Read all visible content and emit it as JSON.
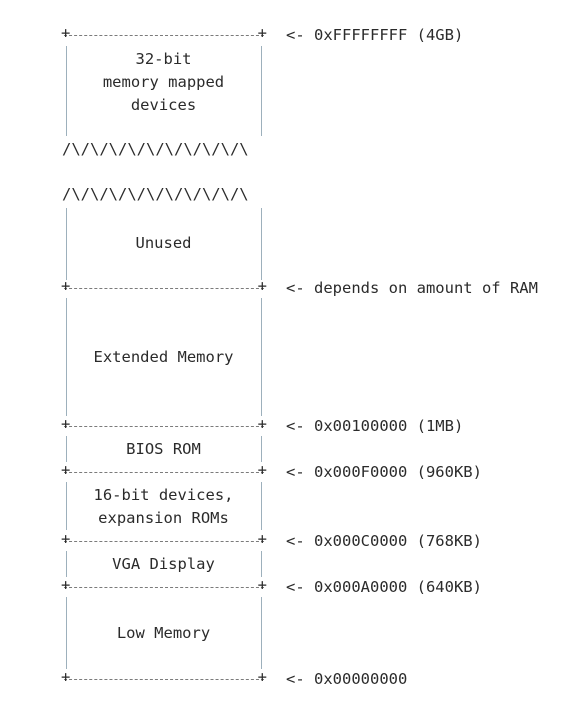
{
  "regions": [
    {
      "id": "32bit",
      "lines": [
        "32-bit",
        "memory mapped",
        "devices"
      ]
    },
    {
      "id": "unused",
      "lines": [
        "Unused"
      ]
    },
    {
      "id": "extended",
      "lines": [
        "Extended Memory"
      ]
    },
    {
      "id": "bios",
      "lines": [
        "BIOS ROM"
      ]
    },
    {
      "id": "16bit",
      "lines": [
        "16-bit devices,",
        "expansion ROMs"
      ]
    },
    {
      "id": "vga",
      "lines": [
        "VGA Display"
      ]
    },
    {
      "id": "low",
      "lines": [
        "Low Memory"
      ]
    }
  ],
  "addresses": {
    "top": "<- 0xFFFFFFFF (4GB)",
    "ram": "<- depends on amount of RAM",
    "mb1": "<- 0x00100000 (1MB)",
    "kb960": "<- 0x000F0000 (960KB)",
    "kb768": "<- 0x000C0000 (768KB)",
    "kb640": "<- 0x000A0000 (640KB)",
    "zero": "<- 0x00000000"
  },
  "break_marks": {
    "upper": "/\\/\\/\\/\\/\\/\\/\\/\\/\\/\\",
    "lower": "/\\/\\/\\/\\/\\/\\/\\/\\/\\/\\"
  }
}
